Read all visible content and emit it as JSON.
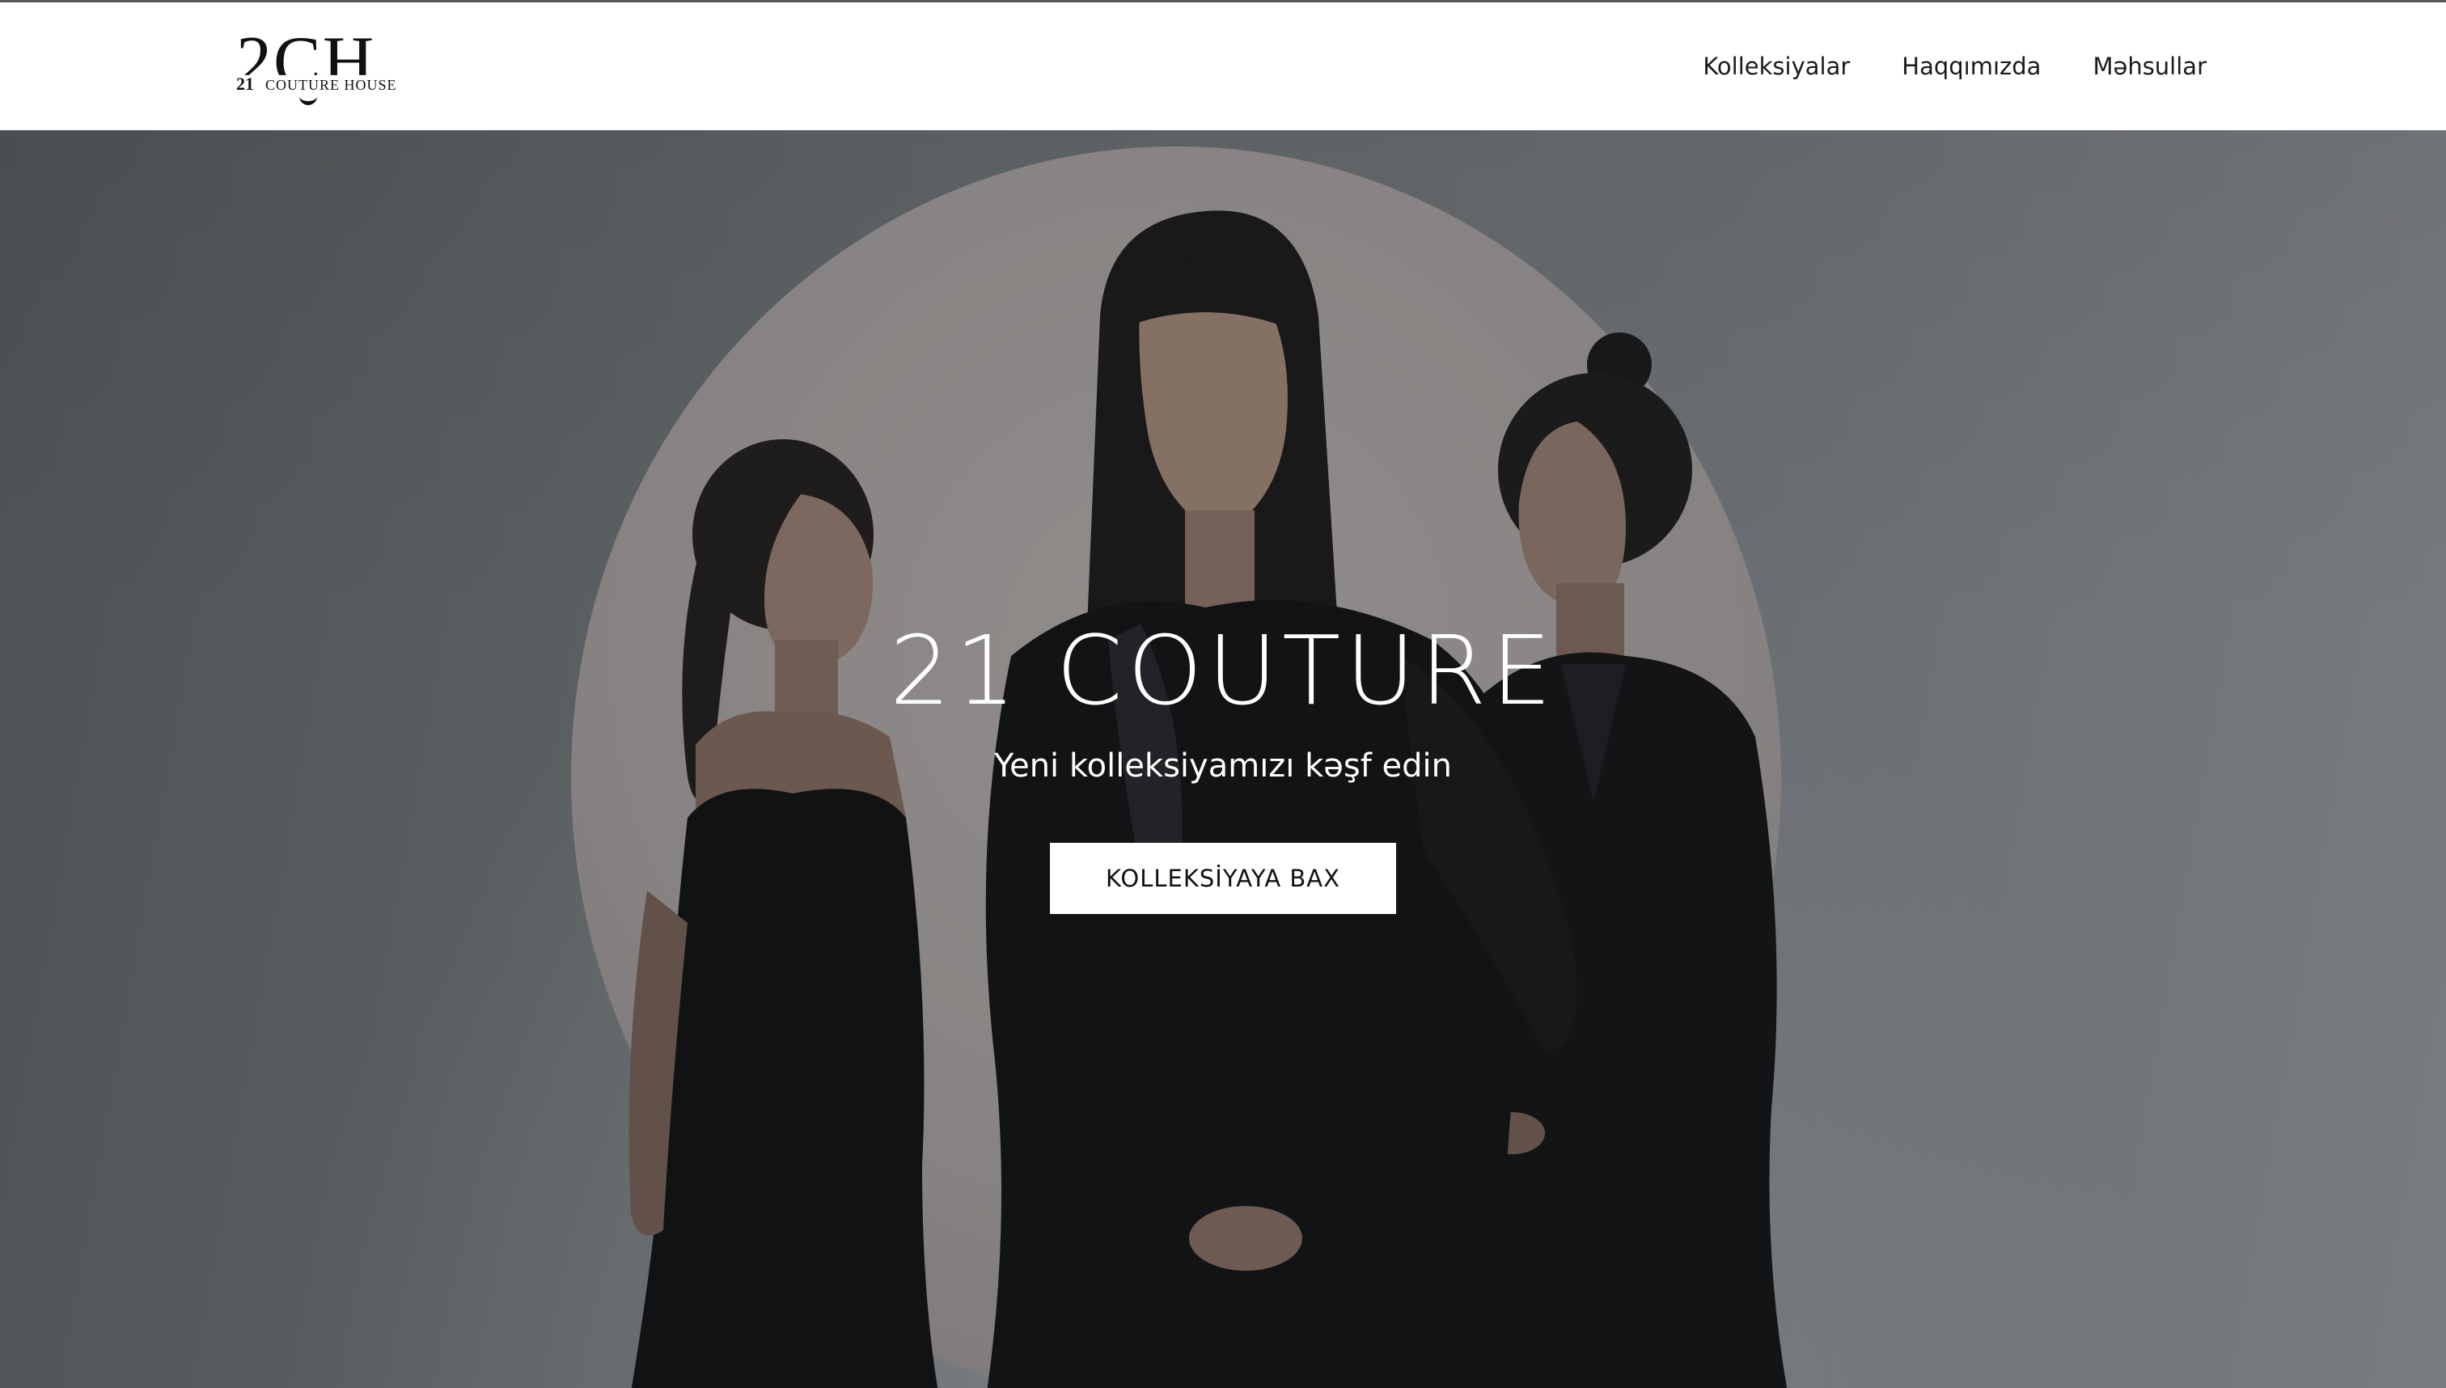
{
  "header": {
    "logo": {
      "mark": "2CH",
      "number": "21",
      "text": "COUTURE HOUSE"
    },
    "nav": [
      {
        "label": "Kolleksiyalar"
      },
      {
        "label": "Haqqımızda"
      },
      {
        "label": "Məhsullar"
      }
    ]
  },
  "hero": {
    "title": "21 COUTURE",
    "subtitle": "Yeni kolleksiyamızı kəşf edin",
    "button_label": "KOLLEKSİYAYA BAX"
  },
  "colors": {
    "header_background": "#ffffff",
    "button_background": "#ffffff",
    "hero_text": "#ffffff",
    "nav_text": "#1a1a1a"
  }
}
